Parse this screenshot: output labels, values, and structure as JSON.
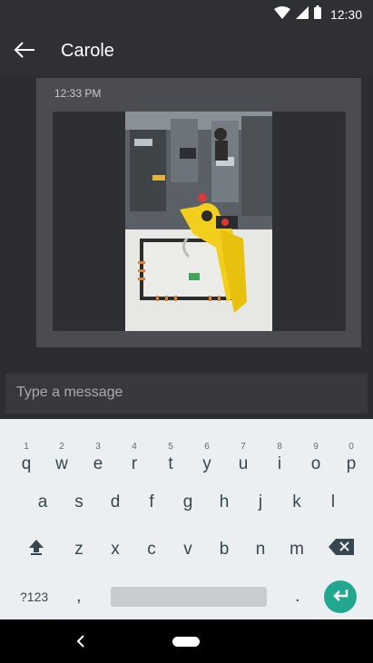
{
  "status_bar": {
    "time": "12:30",
    "icons": [
      "wifi-icon",
      "signal-icon",
      "battery-icon"
    ]
  },
  "app_bar": {
    "title": "Carole",
    "back_icon": "arrow-left-icon"
  },
  "message": {
    "timestamp": "12:33 PM",
    "attachment": "photo of yellow robotic arm in factory"
  },
  "composer": {
    "placeholder": "Type a message"
  },
  "keyboard": {
    "row1": [
      {
        "ch": "q",
        "hint": "1"
      },
      {
        "ch": "w",
        "hint": "2"
      },
      {
        "ch": "e",
        "hint": "3"
      },
      {
        "ch": "r",
        "hint": "4"
      },
      {
        "ch": "t",
        "hint": "5"
      },
      {
        "ch": "y",
        "hint": "6"
      },
      {
        "ch": "u",
        "hint": "7"
      },
      {
        "ch": "i",
        "hint": "8"
      },
      {
        "ch": "o",
        "hint": "9"
      },
      {
        "ch": "p",
        "hint": "0"
      }
    ],
    "row2": [
      "a",
      "s",
      "d",
      "f",
      "g",
      "h",
      "j",
      "k",
      "l"
    ],
    "row3": [
      "z",
      "x",
      "c",
      "v",
      "b",
      "n",
      "m"
    ],
    "symbols_label": "?123",
    "comma": ",",
    "period": ".",
    "accent_color": "#22a88f"
  }
}
